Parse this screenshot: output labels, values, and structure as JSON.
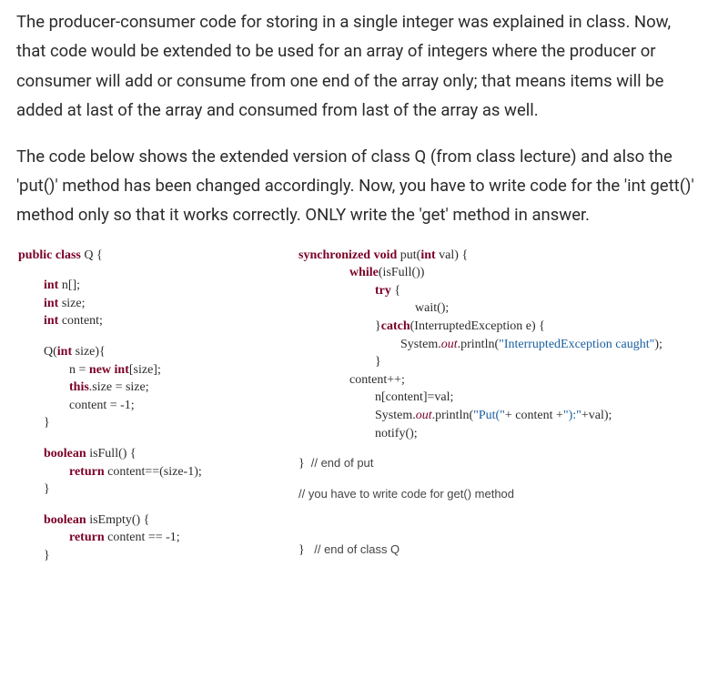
{
  "para1": "The producer-consumer code for storing in a single integer was explained in class. Now, that code would be extended to be used for an array of integers where the producer or consumer will add or consume from one end of the array only; that means items will be added at last of the array and consumed from last of the array as well.",
  "para2": "The code below shows the extended version of class Q (from class lecture) and also the 'put()' method has been changed accordingly. Now, you have to write code for the 'int gett()' method only so that it works correctly. ONLY write the 'get' method in answer.",
  "left": {
    "l1a": "public class",
    "l1b": " Q {",
    "l2a": "int",
    "l2b": " n[];",
    "l3a": "int",
    "l3b": " size;",
    "l4a": "int",
    "l4b": " content;",
    "l5a": "Q(",
    "l5b": "int",
    "l5c": " size){",
    "l6a": "n = ",
    "l6b": "new int",
    "l6c": "[size];",
    "l7a": "this",
    "l7b": ".size = size;",
    "l8": "content = -1;",
    "l9": "}",
    "l10a": "boolean",
    "l10b": " isFull() {",
    "l11a": "return",
    "l11b": " content==(size-1);",
    "l12": "}",
    "l13a": "boolean",
    "l13b": " isEmpty() {",
    "l14a": "return",
    "l14b": " content == -1;",
    "l15": "}"
  },
  "right": {
    "r1a": "synchronized void",
    "r1b": " put(",
    "r1c": "int",
    "r1d": " val) {",
    "r2a": "while",
    "r2b": "(isFull())",
    "r3a": "try",
    "r3b": " {",
    "r4": "wait();",
    "r5a": "}",
    "r5b": "catch",
    "r5c": "(InterruptedException e) {",
    "r6a": "System.",
    "r6b": "out",
    "r6c": ".println(",
    "r6d": "\"InterruptedException caught\"",
    "r6e": ");",
    "r7": "}",
    "r8": "content++;",
    "r9": "n[content]=val;",
    "r10a": "System.",
    "r10b": "out",
    "r10c": ".println(",
    "r10d": "\"Put(\"",
    "r10e": "+ content +",
    "r10f": "\"):\"",
    "r10g": "+val);",
    "r11": "notify();",
    "r12a": "}  ",
    "r12b": "// end of put",
    "r13": "// you have to write code for get() method",
    "r14a": "}   ",
    "r14b": "// end of class Q"
  }
}
